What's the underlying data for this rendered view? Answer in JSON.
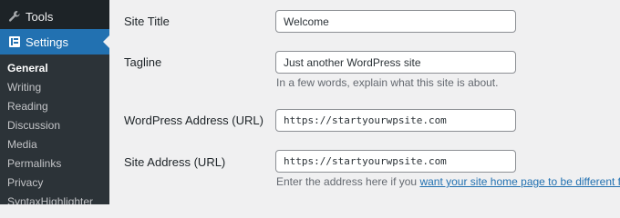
{
  "sidebar": {
    "tools_label": "Tools",
    "settings_label": "Settings",
    "submenu": [
      {
        "label": "General",
        "current": true
      },
      {
        "label": "Writing"
      },
      {
        "label": "Reading"
      },
      {
        "label": "Discussion"
      },
      {
        "label": "Media"
      },
      {
        "label": "Permalinks"
      },
      {
        "label": "Privacy"
      },
      {
        "label": "SyntaxHighlighter"
      }
    ]
  },
  "form": {
    "site_title": {
      "label": "Site Title",
      "value": "Welcome"
    },
    "tagline": {
      "label": "Tagline",
      "value": "Just another WordPress site",
      "description": "In a few words, explain what this site is about."
    },
    "wp_address": {
      "label": "WordPress Address (URL)",
      "value": "https://startyourwpsite.com"
    },
    "site_address": {
      "label": "Site Address (URL)",
      "value": "https://startyourwpsite.com",
      "description_prefix": "Enter the address here if you ",
      "description_link": "want your site home page to be different from your"
    }
  },
  "colors": {
    "sidebar_bg": "#1d2327",
    "active_bg": "#2271b1",
    "link": "#2271b1"
  }
}
